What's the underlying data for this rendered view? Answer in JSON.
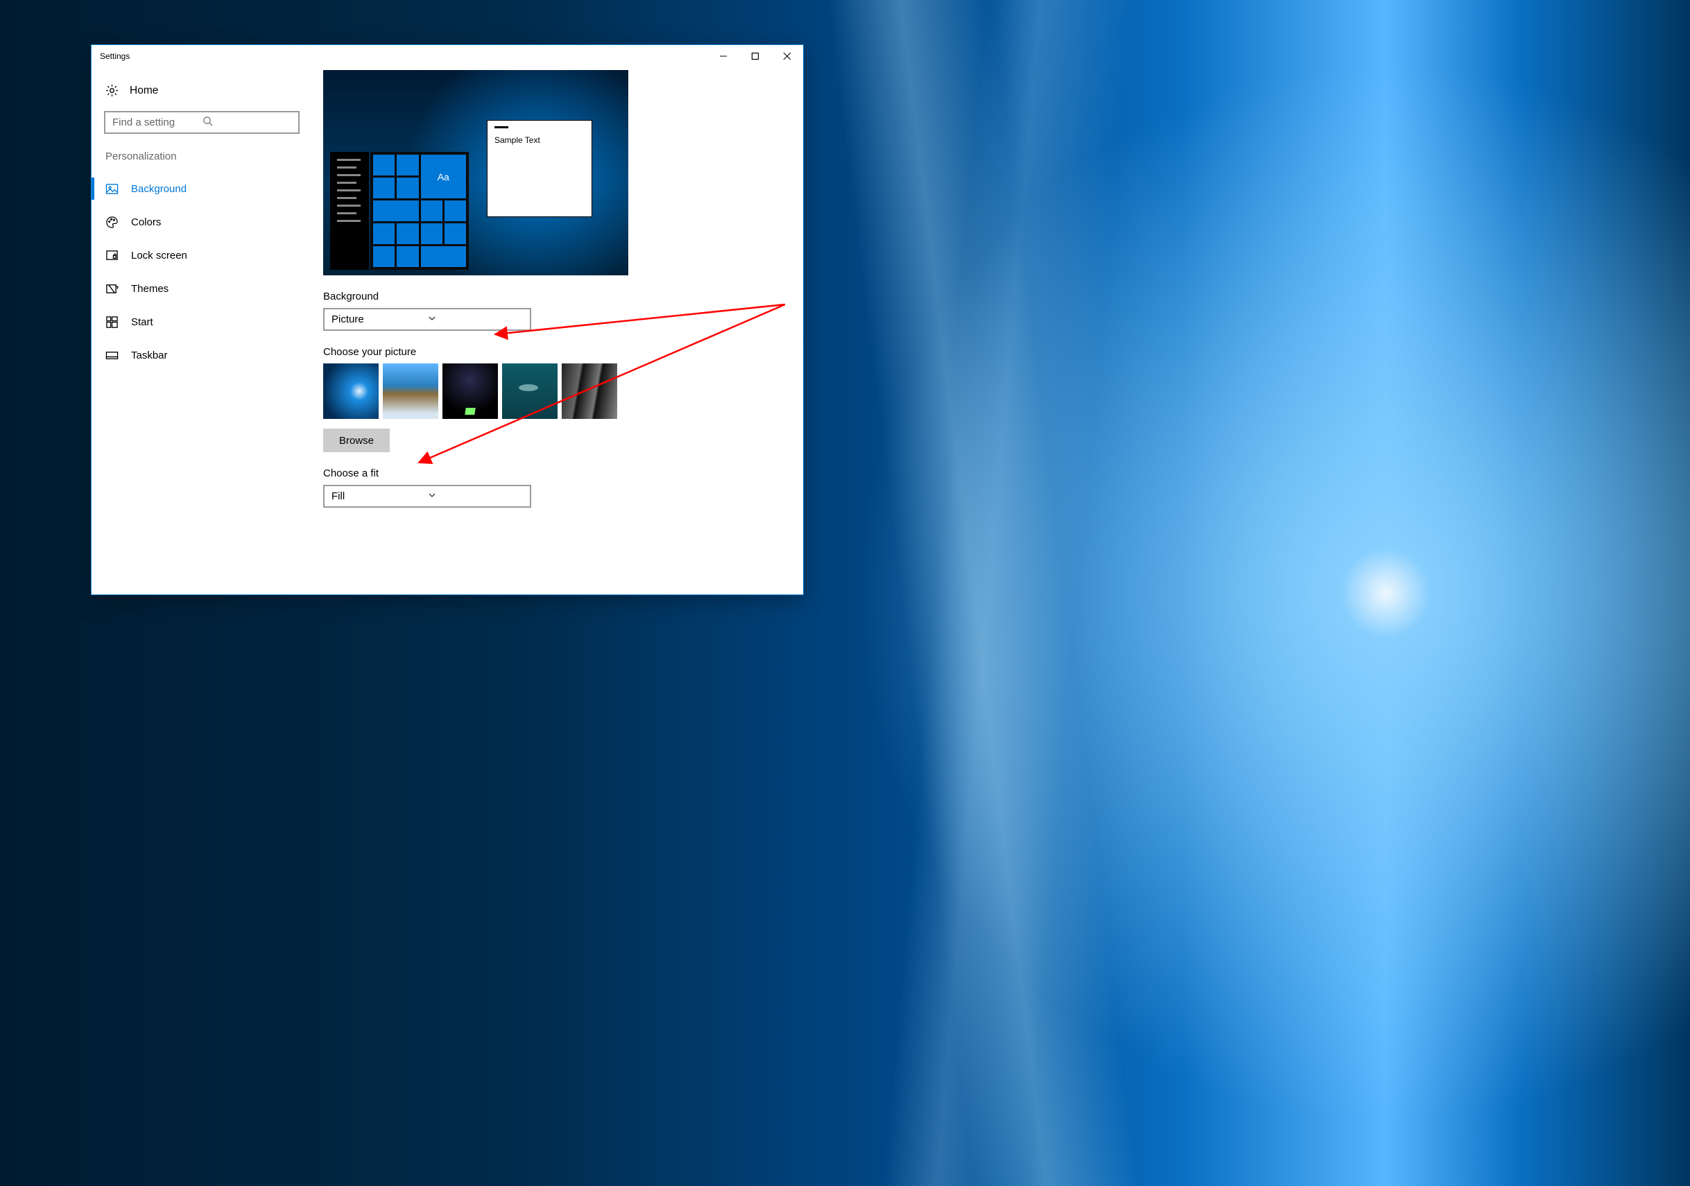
{
  "window": {
    "title": "Settings"
  },
  "sidebar": {
    "home": "Home",
    "search_placeholder": "Find a setting",
    "section": "Personalization",
    "items": [
      {
        "label": "Background",
        "icon": "picture-icon",
        "active": true
      },
      {
        "label": "Colors",
        "icon": "palette-icon"
      },
      {
        "label": "Lock screen",
        "icon": "lockframe-icon"
      },
      {
        "label": "Themes",
        "icon": "themes-icon"
      },
      {
        "label": "Start",
        "icon": "start-icon"
      },
      {
        "label": "Taskbar",
        "icon": "taskbar-icon"
      }
    ]
  },
  "main": {
    "preview_sample_text": "Sample Text",
    "preview_tile_text": "Aa",
    "background_label": "Background",
    "background_value": "Picture",
    "choose_picture_label": "Choose your picture",
    "browse_label": "Browse",
    "fit_label": "Choose a fit",
    "fit_value": "Fill"
  }
}
